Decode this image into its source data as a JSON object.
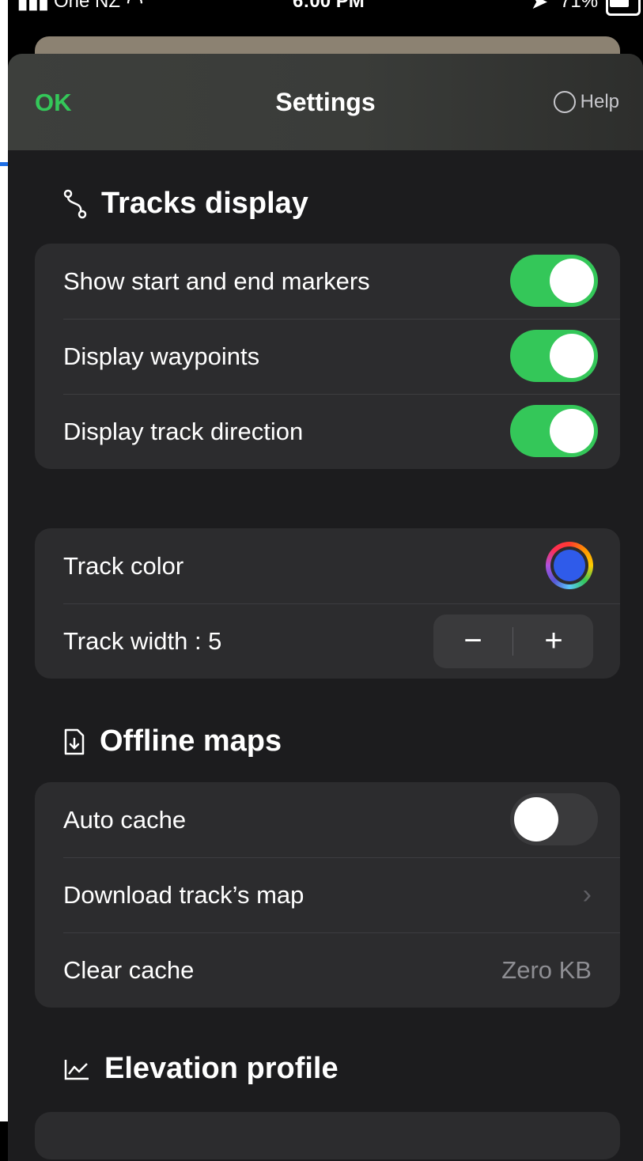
{
  "status_bar": {
    "signal": "▮▮▮",
    "carrier": "One NZ",
    "wifi": "◠",
    "time": "6:00 PM",
    "location": "➤",
    "battery": "71%"
  },
  "nav": {
    "ok_label": "OK",
    "title": "Settings",
    "help_label": "Help"
  },
  "tracks_display": {
    "title": "Tracks display",
    "icon": "route-icon",
    "toggles": [
      {
        "label": "Show start and end markers",
        "on": true
      },
      {
        "label": "Display waypoints",
        "on": true
      },
      {
        "label": "Display track direction",
        "on": true
      }
    ]
  },
  "track_style": {
    "color_label": "Track color",
    "color_value": "#2f5bea",
    "width_label": "Track width : 5",
    "width_value": 5,
    "minus_label": "−",
    "plus_label": "+"
  },
  "offline_maps": {
    "title": "Offline maps",
    "icon": "document-download-icon",
    "auto_cache_label": "Auto cache",
    "auto_cache_on": false,
    "download_label": "Download track’s map",
    "chevron": "›",
    "clear_cache_label": "Clear cache",
    "clear_cache_value": "Zero KB"
  },
  "elevation_profile": {
    "title": "Elevation profile",
    "icon": "chart-line-icon"
  },
  "colors": {
    "accent_green": "#34c759",
    "background": "#1c1c1e",
    "group_background": "#2c2c2e"
  }
}
